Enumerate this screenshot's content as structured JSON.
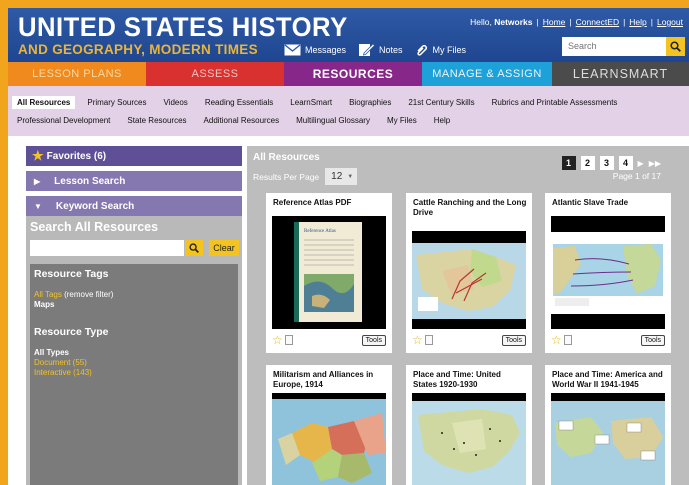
{
  "header": {
    "title_line1": "UNITED STATES HISTORY",
    "title_line2": "AND GEOGRAPHY, MODERN TIMES",
    "greeting_prefix": "Hello, ",
    "user": "Networks",
    "links": [
      "Home",
      "ConnectED",
      "Help",
      "Logout"
    ],
    "messages": "Messages",
    "notes": "Notes",
    "my_files": "My Files",
    "search_placeholder": "Search"
  },
  "tabs": [
    "LESSON PLANS",
    "ASSESS",
    "RESOURCES",
    "MANAGE & ASSIGN",
    "LEARNSMART"
  ],
  "active_tab": "RESOURCES",
  "subnav": {
    "row1": [
      "All Resources",
      "Primary Sources",
      "Videos",
      "Reading Essentials",
      "LearnSmart",
      "Biographies",
      "21st Century Skills",
      "Rubrics and Printable Assessments"
    ],
    "row2": [
      "Professional Development",
      "State Resources",
      "Additional Resources",
      "Multilingual Glossary",
      "My Files",
      "Help"
    ],
    "active": "All Resources"
  },
  "sidebar": {
    "favorites": "Favorites (6)",
    "lesson_search": "Lesson Search",
    "keyword_search": "Keyword Search",
    "search_all_title": "Search All Resources",
    "clear_label": "Clear",
    "resource_tags_heading": "Resource Tags",
    "all_tags": "All Tags",
    "remove_filter": " (remove filter)",
    "tag_maps": "Maps",
    "resource_type_heading": "Resource Type",
    "all_types": "All Types",
    "type_document": "Document (55)",
    "type_interactive": "Interactive (143)"
  },
  "results": {
    "title": "All Resources",
    "per_page_label": "Results Per Page",
    "per_page_value": "12",
    "pages": [
      "1",
      "2",
      "3",
      "4"
    ],
    "current_page": "1",
    "page_of": "Page 1 of 17",
    "tools_label": "Tools",
    "cards": [
      {
        "title": "Reference Atlas PDF"
      },
      {
        "title": "Cattle Ranching and the Long Drive"
      },
      {
        "title": "Atlantic Slave Trade"
      },
      {
        "title": "Militarism and Alliances in Europe, 1914"
      },
      {
        "title": "Place and Time: United States 1920-1930"
      },
      {
        "title": "Place and Time: America and World War II 1941-1945"
      }
    ],
    "atlas_cover_text": "Reference Atlas"
  },
  "colors": {
    "header_blue": "#2f5aa6",
    "accent_gold": "#f3c321",
    "tab_lesson": "#f08a1e",
    "tab_assess": "#d9312f",
    "tab_resources": "#88278a",
    "tab_manage": "#1ea0d9",
    "tab_learnsmart": "#4b4b4b",
    "subnav_bg": "#e3d1e7",
    "page_border": "#f0a51c"
  }
}
